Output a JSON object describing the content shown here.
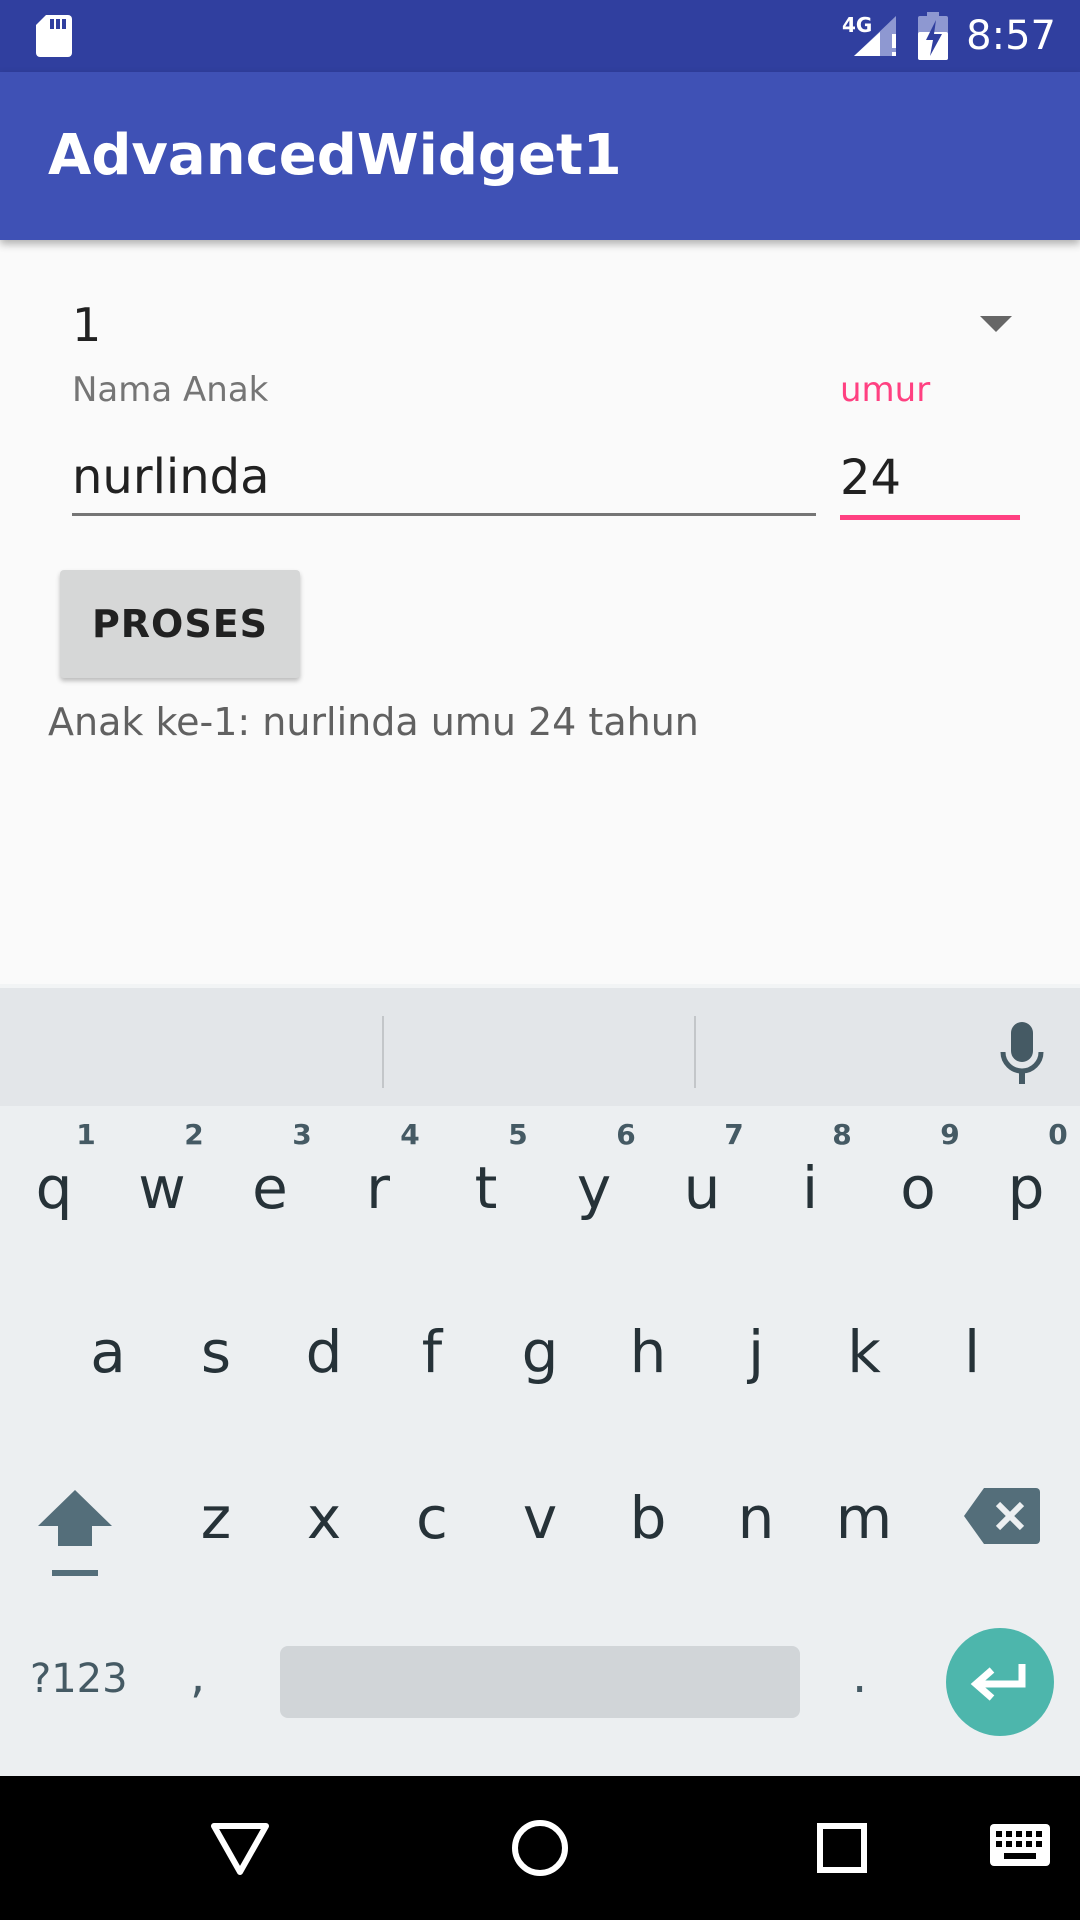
{
  "status_bar": {
    "time": "8:57",
    "network_label": "4G",
    "icons": [
      "sd-card-icon",
      "signal-icon",
      "battery-icon"
    ]
  },
  "app_bar": {
    "title": "AdvancedWidget1",
    "color": "#3f51b5"
  },
  "form": {
    "spinner_value": "1",
    "nama_label": "Nama Anak",
    "nama_value": "nurlinda",
    "umur_label": "umur",
    "umur_value": "24",
    "accent_color": "#ff4081",
    "button_label": "PROSES",
    "result": "Anak ke-1: nurlinda umu 24 tahun"
  },
  "keyboard": {
    "row1": [
      "q",
      "w",
      "e",
      "r",
      "t",
      "y",
      "u",
      "i",
      "o",
      "p"
    ],
    "row1_hints": [
      "1",
      "2",
      "3",
      "4",
      "5",
      "6",
      "7",
      "8",
      "9",
      "0"
    ],
    "row2": [
      "a",
      "s",
      "d",
      "f",
      "g",
      "h",
      "j",
      "k",
      "l"
    ],
    "row3": [
      "z",
      "x",
      "c",
      "v",
      "b",
      "n",
      "m"
    ],
    "symbols_label": "?123",
    "comma": ",",
    "period": ".",
    "enter_color": "#4db6ac"
  },
  "nav_bar": {
    "icons": [
      "back-icon",
      "home-icon",
      "recents-icon",
      "keyboard-switch-icon"
    ]
  }
}
